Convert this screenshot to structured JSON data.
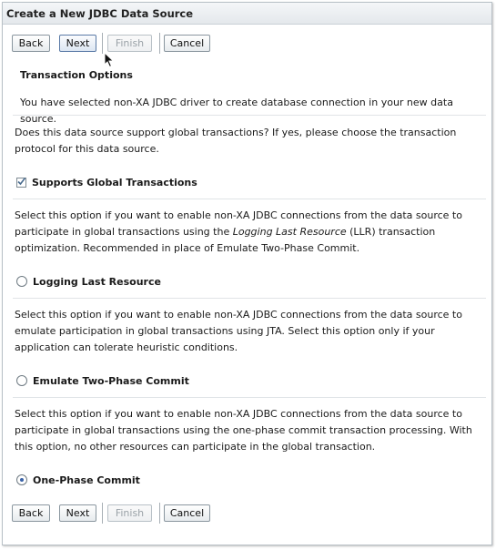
{
  "window": {
    "title": "Create a New JDBC Data Source"
  },
  "buttons": {
    "back": "Back",
    "next": "Next",
    "finish": "Finish",
    "cancel": "Cancel"
  },
  "section": {
    "heading": "Transaction Options",
    "intro": "You have selected non-XA JDBC driver to create database connection in your new data source."
  },
  "question": "Does this data source support global transactions? If yes, please choose the transaction protocol for this data source.",
  "supports_global": {
    "label": "Supports Global Transactions",
    "checked": true
  },
  "options": [
    {
      "description_pre": "Select this option if you want to enable non-XA JDBC connections from the data source to participate in global transactions using the ",
      "description_em": "Logging Last Resource",
      "description_post": " (LLR) transaction optimization. Recommended in place of Emulate Two-Phase Commit.",
      "label": "Logging Last Resource",
      "selected": false
    },
    {
      "description": "Select this option if you want to enable non-XA JDBC connections from the data source to emulate participation in global transactions using JTA. Select this option only if your application can tolerate heuristic conditions.",
      "label": "Emulate Two-Phase Commit",
      "selected": false
    },
    {
      "description": "Select this option if you want to enable non-XA JDBC connections from the data source to participate in global transactions using the one-phase commit transaction processing. With this option, no other resources can participate in the global transaction.",
      "label": "One-Phase Commit",
      "selected": true
    }
  ],
  "icons": {
    "checkmark": "checkmark-icon",
    "cursor": "mouse-pointer-icon"
  },
  "colors": {
    "accent": "#3a63a8",
    "border": "#b9c1c7"
  }
}
